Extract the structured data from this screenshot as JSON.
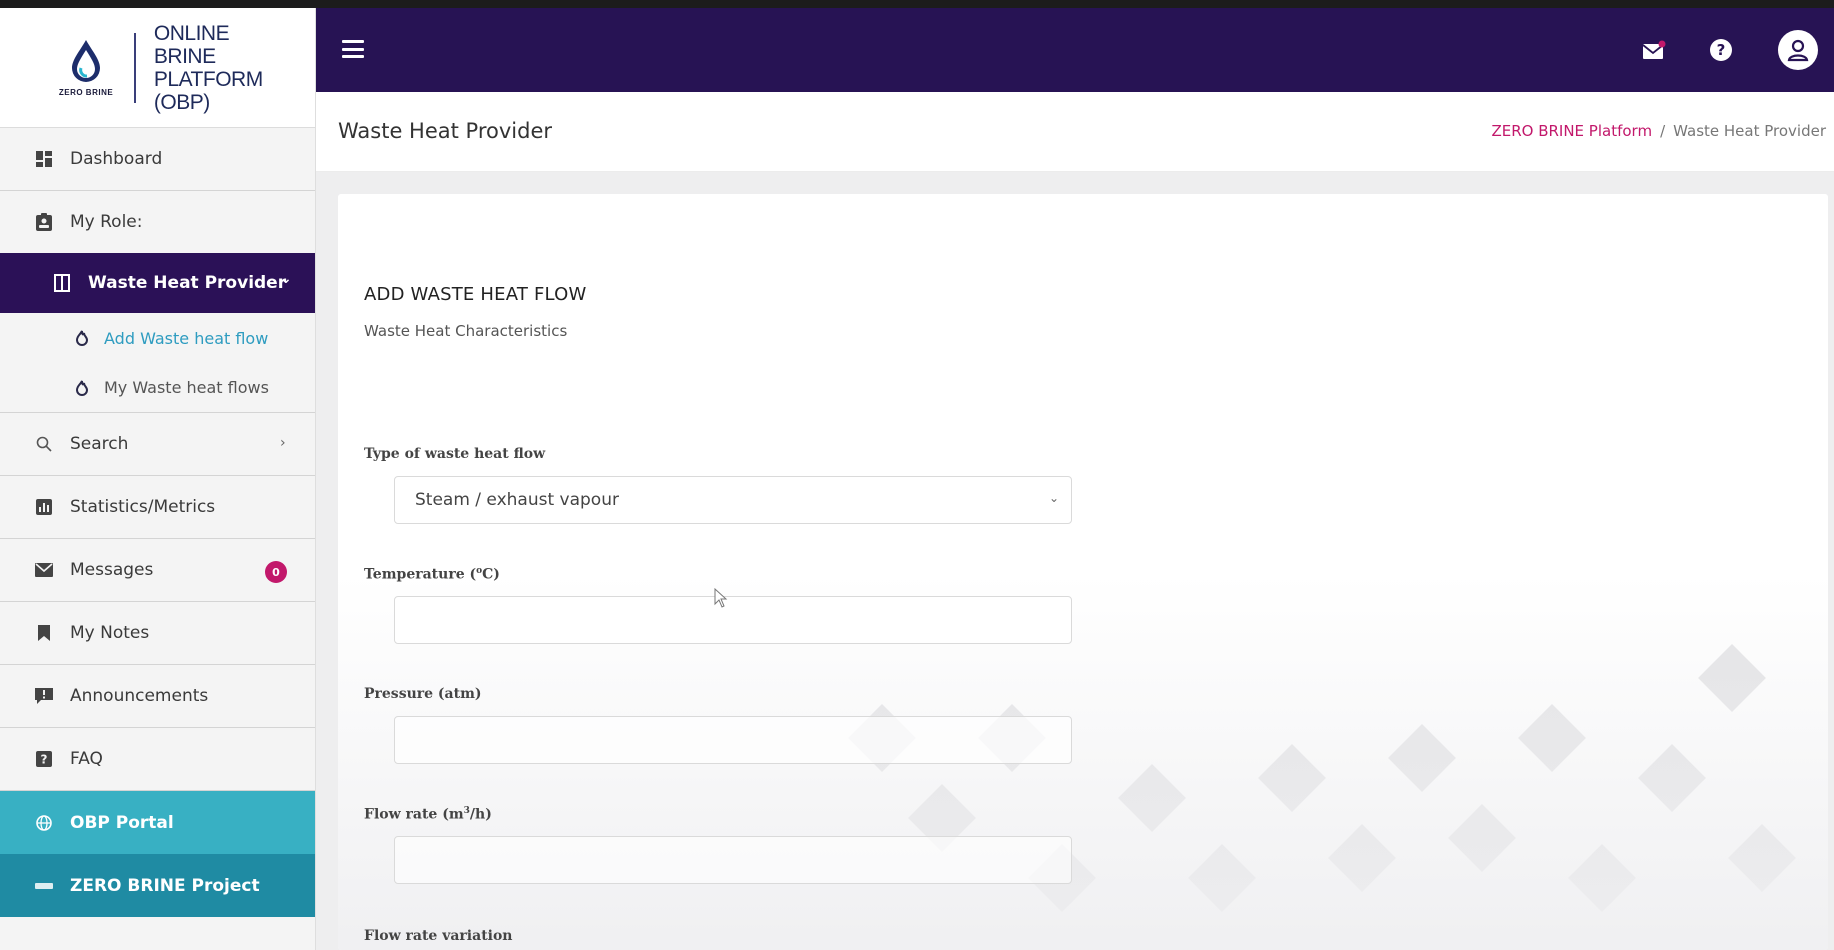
{
  "brand": {
    "logo_caption": "ZERO BRINE",
    "name_lines": [
      "ONLINE",
      "BRINE",
      "PLATFORM (OBP)"
    ]
  },
  "sidebar": {
    "dashboard": "Dashboard",
    "my_role": "My Role:",
    "role_active": "Waste Heat Provider",
    "sub_items": [
      {
        "label": "Add Waste heat flow",
        "current": true
      },
      {
        "label": "My Waste heat flows",
        "current": false
      }
    ],
    "search": "Search",
    "statistics": "Statistics/Metrics",
    "messages": "Messages",
    "messages_count": "0",
    "notes": "My Notes",
    "announcements": "Announcements",
    "faq": "FAQ",
    "portal": "OBP Portal",
    "project": "ZERO BRINE Project",
    "colors": {
      "active_role": "#2b1157",
      "portal": "#38b0c3",
      "project": "#1f8ba3",
      "badge": "#c2186b"
    }
  },
  "header": {
    "menu_icon": "hamburger-icon",
    "icons": [
      "mail-icon",
      "help-icon",
      "user-icon"
    ],
    "color": "#271354"
  },
  "page": {
    "title": "Waste Heat Provider",
    "breadcrumb": {
      "root": "ZERO BRINE Platform",
      "separator": "/",
      "current": "Waste Heat Provider"
    }
  },
  "form": {
    "title": "ADD WASTE HEAT FLOW",
    "subtitle": "Waste Heat Characteristics",
    "fields": {
      "type": {
        "label": "Type of waste heat flow",
        "value": "Steam / exhaust vapour"
      },
      "temperature": {
        "label_prefix": "Temperature (",
        "label_sup": "o",
        "label_suffix": "C)",
        "value": ""
      },
      "pressure": {
        "label": "Pressure (atm)",
        "value": ""
      },
      "flow_rate": {
        "label_prefix": "Flow rate (m",
        "label_sup": "3",
        "label_suffix": "/h)",
        "value": ""
      },
      "flow_rate_variation": {
        "label": "Flow rate variation"
      }
    }
  }
}
